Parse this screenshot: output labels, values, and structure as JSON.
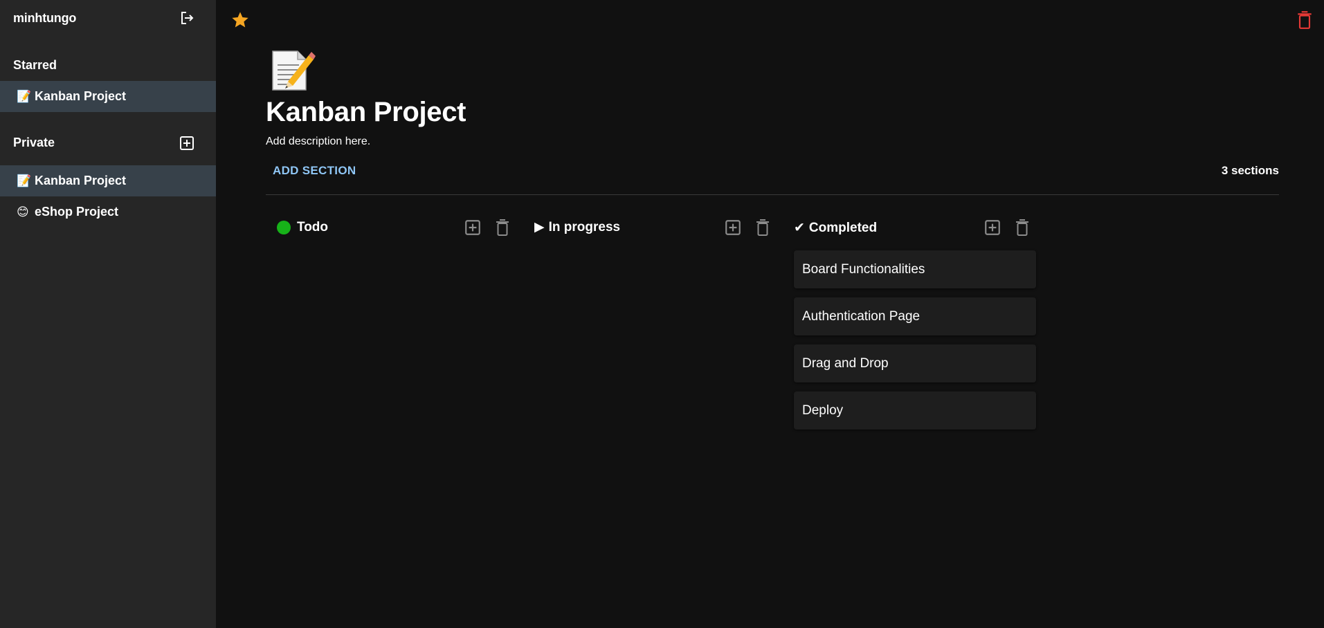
{
  "sidebar": {
    "username": "minhtungo",
    "logout_icon": "logout-icon",
    "starred": {
      "title": "Starred",
      "items": [
        {
          "emoji": "📝",
          "label": "Kanban Project",
          "active": true
        }
      ]
    },
    "private": {
      "title": "Private",
      "add_icon": "add-box-icon",
      "items": [
        {
          "emoji": "📝",
          "label": "Kanban Project",
          "active": true
        },
        {
          "emoji": "😊",
          "label": "eShop Project",
          "active": false
        }
      ]
    }
  },
  "topbar": {
    "star_icon": "star-icon",
    "star_color": "#f5a623",
    "delete_icon": "trash-icon",
    "delete_color": "#e53935"
  },
  "board": {
    "icon": "📝",
    "title": "Kanban Project",
    "description": "Add description here.",
    "add_section_label": "ADD SECTION",
    "section_count": "3 sections",
    "accent_color": "#8fc6f5"
  },
  "sections": [
    {
      "marker": "dot",
      "marker_color": "#17b219",
      "title": "Todo",
      "cards": []
    },
    {
      "marker": "▶",
      "title": "In progress",
      "cards": []
    },
    {
      "marker": "✔",
      "title": "Completed",
      "cards": [
        "Board Functionalities",
        "Authentication Page",
        "Drag and Drop",
        "Deploy"
      ]
    }
  ]
}
